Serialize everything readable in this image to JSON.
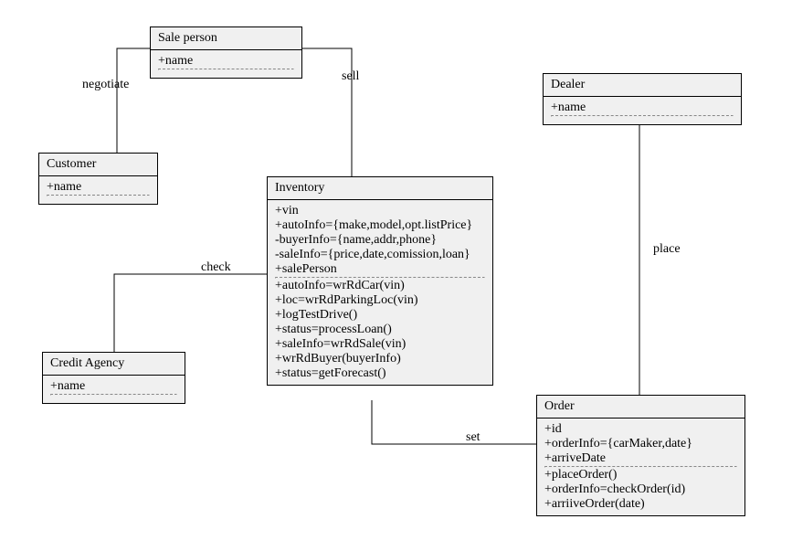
{
  "diagram": {
    "type": "uml-class",
    "classes": {
      "salePerson": {
        "name": "Sale person",
        "attrs": [
          "+name"
        ],
        "ops": []
      },
      "customer": {
        "name": "Customer",
        "attrs": [
          "+name"
        ],
        "ops": []
      },
      "dealer": {
        "name": "Dealer",
        "attrs": [
          "+name"
        ],
        "ops": []
      },
      "creditAgency": {
        "name": "Credit Agency",
        "attrs": [
          "+name"
        ],
        "ops": []
      },
      "inventory": {
        "name": "Inventory",
        "attrs": [
          "+vin",
          "+autoInfo={make,model,opt.listPrice}",
          "-buyerInfo={name,addr,phone}",
          "-saleInfo={price,date,comission,loan}",
          "+salePerson"
        ],
        "ops": [
          "+autoInfo=wrRdCar(vin)",
          "+loc=wrRdParkingLoc(vin)",
          "+logTestDrive()",
          "+status=processLoan()",
          "+saleInfo=wrRdSale(vin)",
          "+wrRdBuyer(buyerInfo)",
          "+status=getForecast()"
        ]
      },
      "order": {
        "name": "Order",
        "attrs": [
          "+id",
          "+orderInfo={carMaker,date}",
          "+arriveDate"
        ],
        "ops": [
          "+placeOrder()",
          "+orderInfo=checkOrder(id)",
          "+arriiveOrder(date)"
        ]
      }
    },
    "relations": {
      "negotiate": {
        "label": "negotiate",
        "from": "salePerson",
        "to": "customer"
      },
      "sell": {
        "label": "sell",
        "from": "salePerson",
        "to": "inventory"
      },
      "check": {
        "label": "check",
        "from": "creditAgency",
        "to": "inventory"
      },
      "set": {
        "label": "set",
        "from": "inventory",
        "to": "order"
      },
      "place": {
        "label": "place",
        "from": "dealer",
        "to": "order"
      }
    }
  }
}
